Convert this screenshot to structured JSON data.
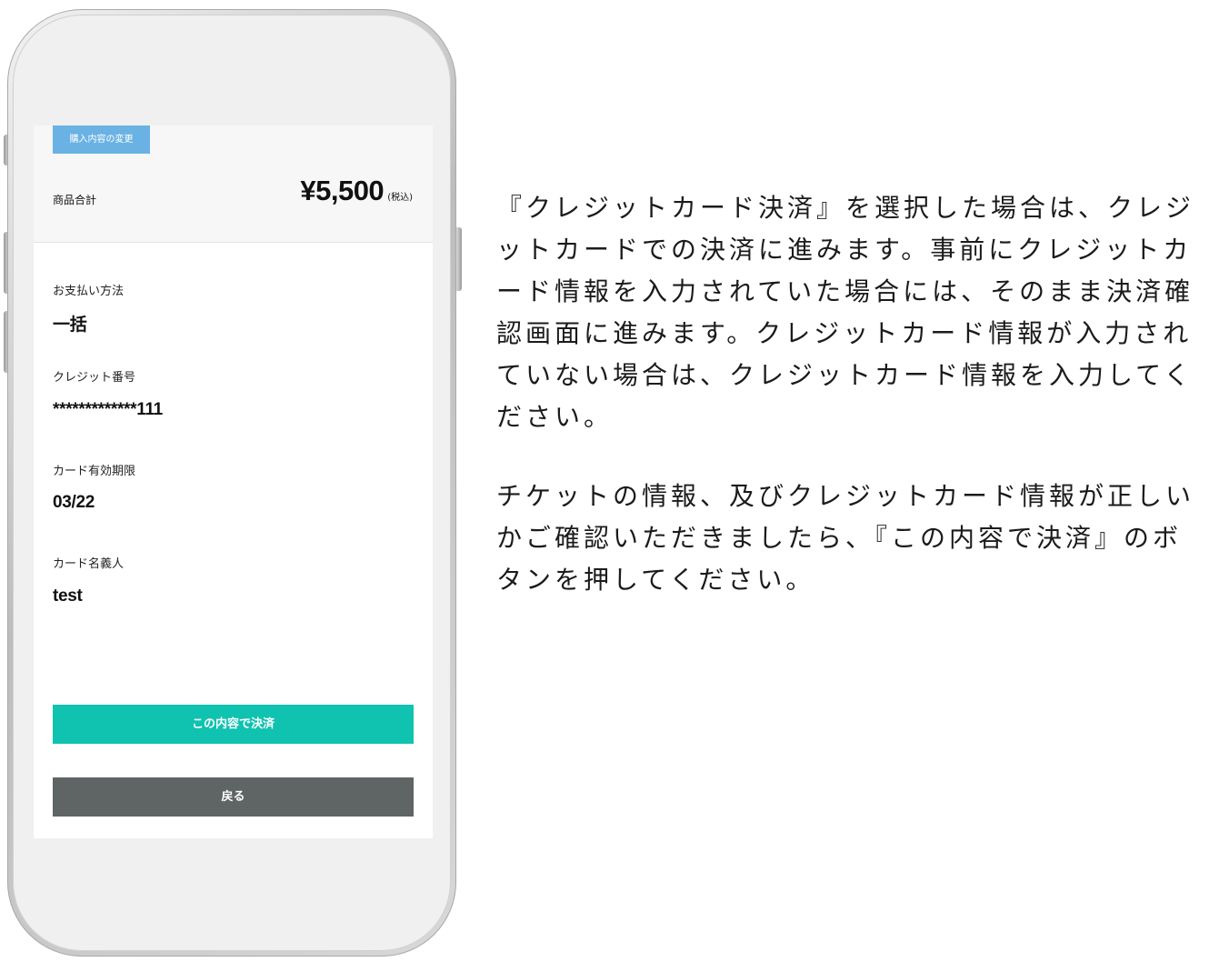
{
  "screen": {
    "change_button": "購入内容の変更",
    "total_label": "商品合計",
    "total_price": "¥5,500",
    "total_tax_note": "(税込)",
    "fields": [
      {
        "label": "お支払い方法",
        "value": "一括"
      },
      {
        "label": "クレジット番号",
        "value": "*************111"
      },
      {
        "label": "カード有効期限",
        "value": "03/22"
      },
      {
        "label": "カード名義人",
        "value": "test"
      }
    ],
    "confirm_button": "この内容で決済",
    "back_button": "戻る"
  },
  "colors": {
    "change_button": "#6ab2e3",
    "confirm_button": "#10c2b0",
    "back_button": "#5f6565"
  },
  "explanation": {
    "paragraph1": "『クレジットカード決済』を選択した場合は、クレジットカードでの決済に進みます。事前にクレジットカード情報を入力されていた場合には、そのまま決済確認画面に進みます。クレジットカード情報が入力されていない場合は、クレジットカード情報を入力してください。",
    "paragraph2": "チケットの情報、及びクレジットカード情報が正しいかご確認いただきましたら、『この内容で決済』のボタンを押してください。"
  }
}
